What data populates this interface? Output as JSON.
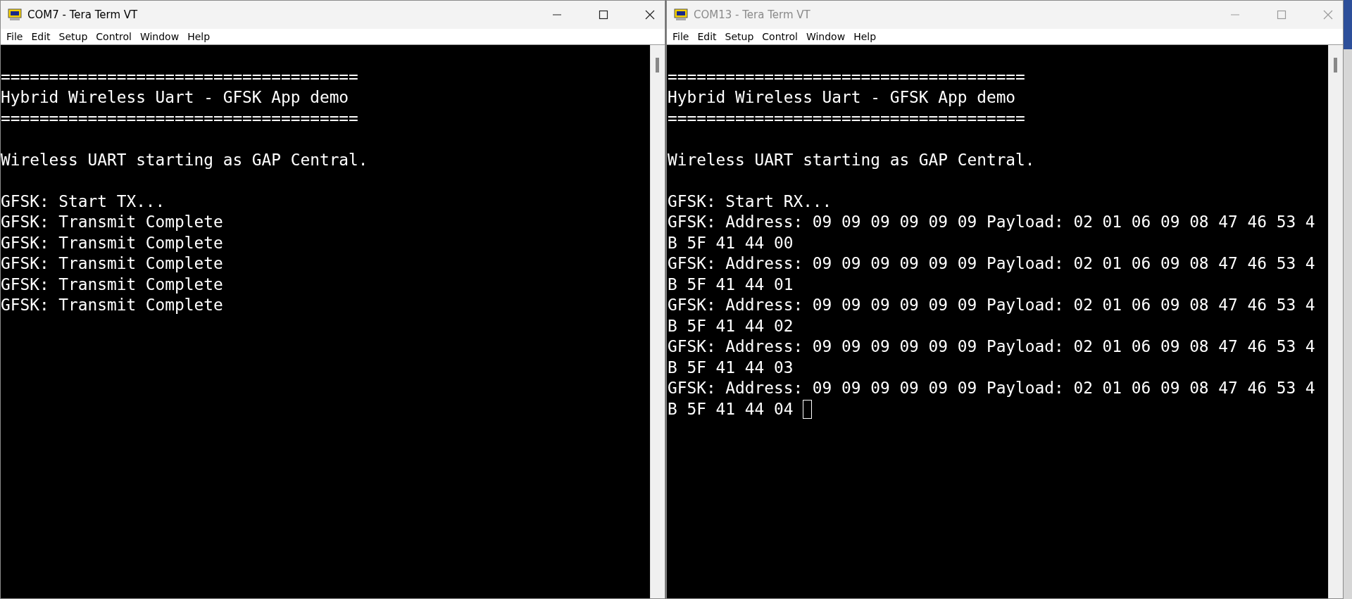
{
  "windows": [
    {
      "title": "COM7 - Tera Term VT",
      "active": true,
      "cursor": false,
      "menu": [
        "File",
        "Edit",
        "Setup",
        "Control",
        "Window",
        "Help"
      ],
      "lines": [
        {
          "kind": "blank"
        },
        {
          "kind": "text",
          "text": "====================================="
        },
        {
          "kind": "text",
          "text": "Hybrid Wireless Uart - GFSK App demo"
        },
        {
          "kind": "text",
          "text": "====================================="
        },
        {
          "kind": "blank"
        },
        {
          "kind": "text",
          "text": "Wireless UART starting as GAP Central."
        },
        {
          "kind": "blank"
        },
        {
          "kind": "text",
          "text": "GFSK: Start TX..."
        },
        {
          "kind": "text",
          "text": "GFSK: Transmit Complete"
        },
        {
          "kind": "text",
          "text": "GFSK: Transmit Complete"
        },
        {
          "kind": "text",
          "text": "GFSK: Transmit Complete"
        },
        {
          "kind": "text",
          "text": "GFSK: Transmit Complete"
        },
        {
          "kind": "text",
          "text": "GFSK: Transmit Complete"
        }
      ]
    },
    {
      "title": "COM13 - Tera Term VT",
      "active": false,
      "cursor": true,
      "menu": [
        "File",
        "Edit",
        "Setup",
        "Control",
        "Window",
        "Help"
      ],
      "lines": [
        {
          "kind": "blank"
        },
        {
          "kind": "text",
          "text": "====================================="
        },
        {
          "kind": "text",
          "text": "Hybrid Wireless Uart - GFSK App demo"
        },
        {
          "kind": "text",
          "text": "====================================="
        },
        {
          "kind": "blank"
        },
        {
          "kind": "text",
          "text": "Wireless UART starting as GAP Central."
        },
        {
          "kind": "blank"
        },
        {
          "kind": "text",
          "text": "GFSK: Start RX..."
        },
        {
          "kind": "text",
          "text": "GFSK: Address: 09 09 09 09 09 09 Payload: 02 01 06 09 08 47 46 53 4"
        },
        {
          "kind": "text",
          "text": "B 5F 41 44 00"
        },
        {
          "kind": "text",
          "text": "GFSK: Address: 09 09 09 09 09 09 Payload: 02 01 06 09 08 47 46 53 4"
        },
        {
          "kind": "text",
          "text": "B 5F 41 44 01"
        },
        {
          "kind": "text",
          "text": "GFSK: Address: 09 09 09 09 09 09 Payload: 02 01 06 09 08 47 46 53 4"
        },
        {
          "kind": "text",
          "text": "B 5F 41 44 02"
        },
        {
          "kind": "text",
          "text": "GFSK: Address: 09 09 09 09 09 09 Payload: 02 01 06 09 08 47 46 53 4"
        },
        {
          "kind": "text",
          "text": "B 5F 41 44 03"
        },
        {
          "kind": "text",
          "text": "GFSK: Address: 09 09 09 09 09 09 Payload: 02 01 06 09 08 47 46 53 4"
        },
        {
          "kind": "text",
          "text": "B 5F 41 44 04"
        }
      ]
    }
  ]
}
